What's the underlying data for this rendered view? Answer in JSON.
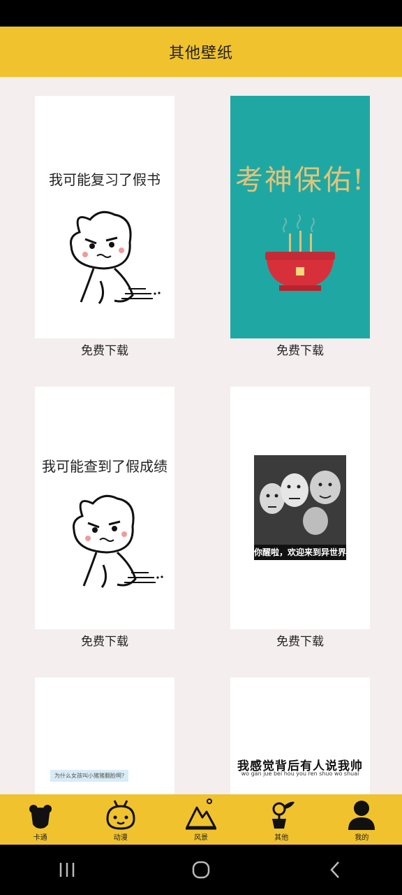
{
  "header": {
    "title": "其他壁纸"
  },
  "cards": [
    {
      "caption": "免费下载",
      "text": "我可能复习了假书"
    },
    {
      "caption": "免费下载",
      "text": "考神保佑!"
    },
    {
      "caption": "免费下载",
      "text": "我可能查到了假成绩"
    },
    {
      "caption": "免费下载",
      "text": "你醒啦，欢迎来到异世界"
    },
    {
      "caption": "",
      "text": "为什么女孩叫小猪猪翻脸啊?"
    },
    {
      "caption": "",
      "text": "我感觉背后有人说我帅",
      "subtext": "wo gan jue bei hou you ren shuo wo shuai"
    }
  ],
  "bottom_nav": [
    {
      "label": "卡通",
      "icon": "bear-icon"
    },
    {
      "label": "动漫",
      "icon": "cartoon-face-icon"
    },
    {
      "label": "风景",
      "icon": "mountain-icon"
    },
    {
      "label": "其他",
      "icon": "plant-pot-icon"
    },
    {
      "label": "我的",
      "icon": "user-icon"
    }
  ],
  "colors": {
    "accent": "#f0c22e",
    "background": "#f4eeee",
    "teal": "#1fa8a3"
  }
}
